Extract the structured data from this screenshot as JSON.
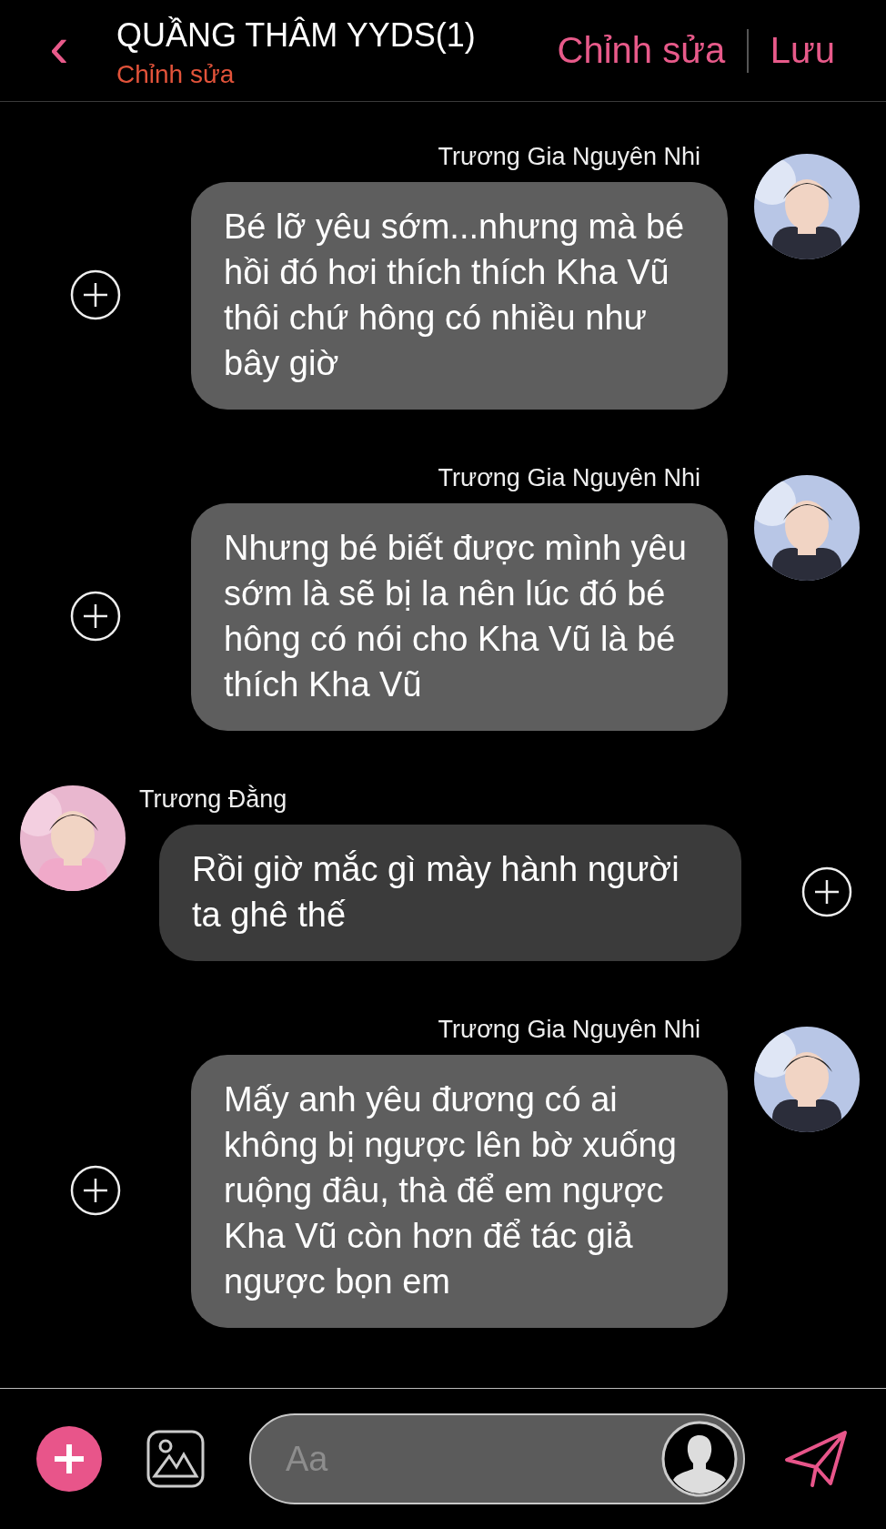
{
  "header": {
    "back": "‹",
    "title": "QUẦNG THÂM YYDS(1)",
    "subtitle": "Chỉnh sửa",
    "actions": [
      "Chỉnh sửa",
      "Lưu"
    ]
  },
  "messages": [
    {
      "kind": "sent",
      "sender": "Trương Gia Nguyên Nhi",
      "text": "Bé lỡ yêu sớm...nhưng mà bé hồi đó hơi thích thích Kha Vũ thôi chứ hông có nhiều như bây giờ"
    },
    {
      "kind": "sent",
      "sender": "Trương Gia Nguyên Nhi",
      "text": "Nhưng bé biết được mình yêu sớm là sẽ bị la nên lúc đó bé hông có nói cho Kha Vũ là bé thích Kha Vũ"
    },
    {
      "kind": "received",
      "sender": "Trương Đằng",
      "text": "Rồi giờ mắc gì mày hành người ta ghê thế"
    },
    {
      "kind": "sent",
      "sender": "Trương Gia Nguyên Nhi",
      "text": "Mấy anh yêu đương có ai không bị ngược lên bờ xuống ruộng đâu, thà để em ngược Kha Vũ còn hơn để tác giả ngược bọn em"
    }
  ],
  "composer": {
    "placeholder": "Aa"
  }
}
